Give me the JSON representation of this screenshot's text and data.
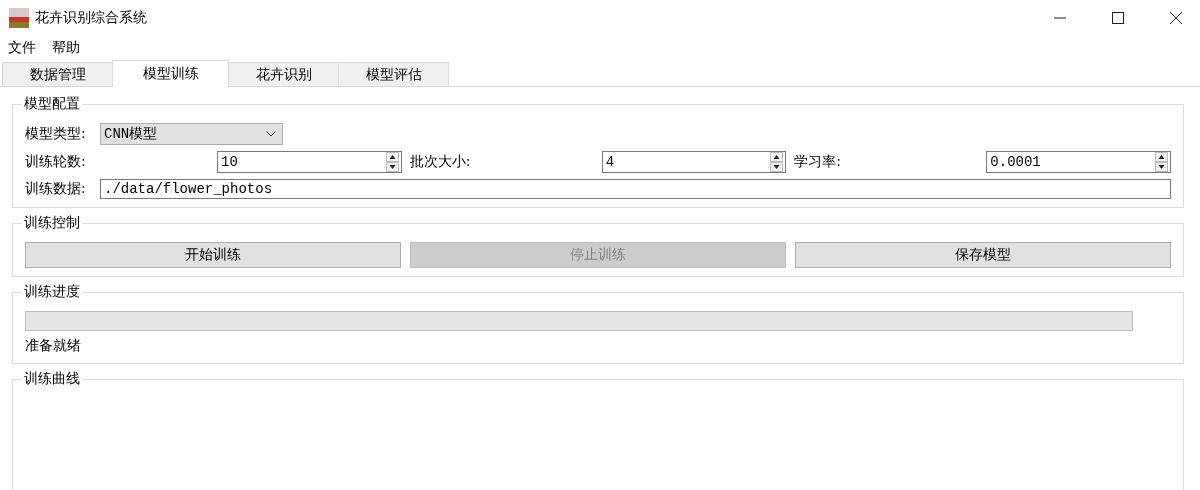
{
  "window": {
    "title": "花卉识别综合系统"
  },
  "menu": [
    "文件",
    "帮助"
  ],
  "tabs": [
    {
      "label": "数据管理",
      "selected": false
    },
    {
      "label": "模型训练",
      "selected": true
    },
    {
      "label": "花卉识别",
      "selected": false
    },
    {
      "label": "模型评估",
      "selected": false
    }
  ],
  "model_config": {
    "title": "模型配置",
    "model_type": {
      "label": "模型类型:",
      "value": "CNN模型"
    },
    "spin_fields": [
      {
        "label": "训练轮数:",
        "value": "10"
      },
      {
        "label": "批次大小:",
        "value": "4"
      },
      {
        "label": "学习率:",
        "value": "0.0001"
      }
    ],
    "train_data": {
      "label": "训练数据:",
      "value": "./data/flower_photos"
    }
  },
  "training_control": {
    "title": "训练控制",
    "buttons": [
      {
        "label": "开始训练",
        "disabled": false
      },
      {
        "label": "停止训练",
        "disabled": true
      },
      {
        "label": "保存模型",
        "disabled": false
      }
    ]
  },
  "progress": {
    "title": "训练进度",
    "level": 0,
    "status": "准备就绪"
  },
  "curve": {
    "title": "训练曲线"
  }
}
